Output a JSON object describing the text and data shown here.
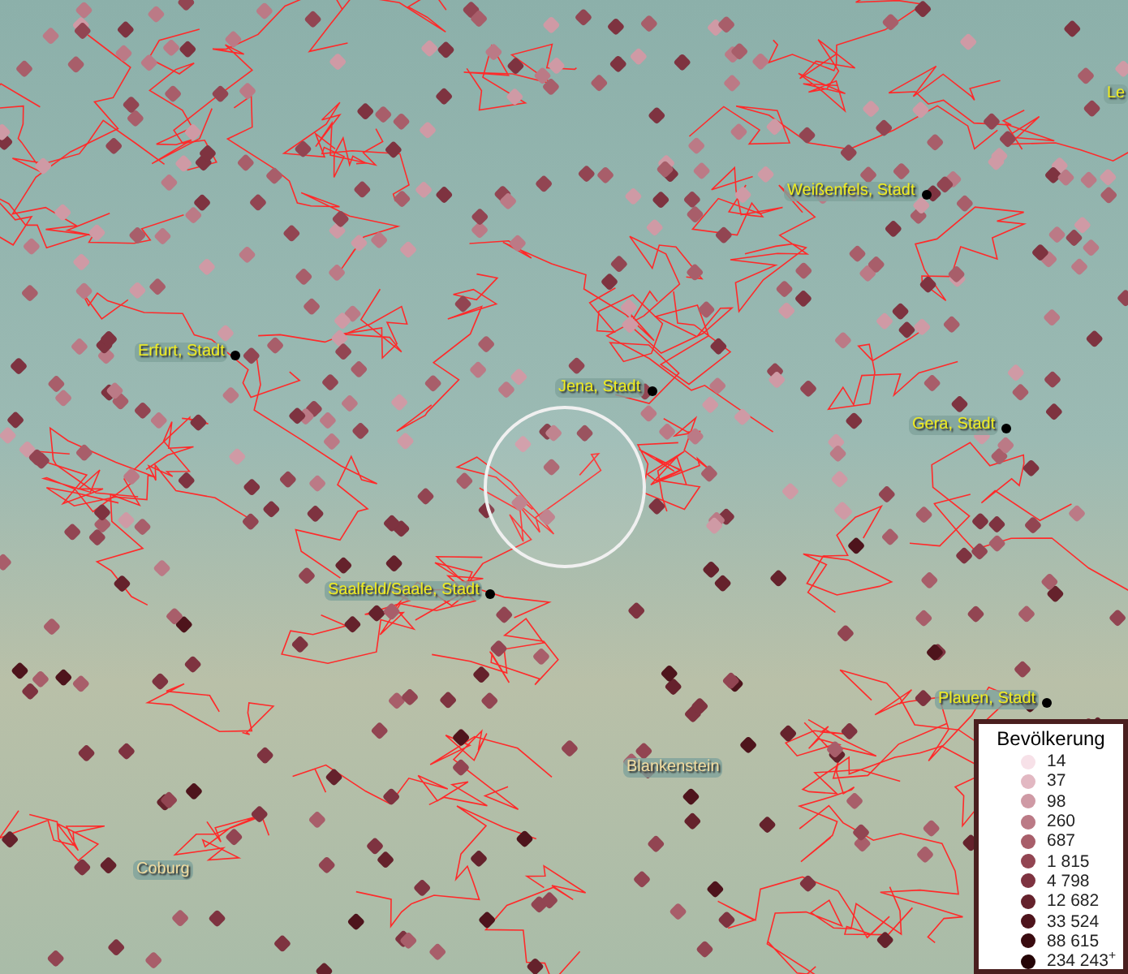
{
  "map": {
    "places": [
      {
        "name": "Le",
        "kind": "city"
      },
      {
        "name": "Weißenfels, Stadt",
        "kind": "city"
      },
      {
        "name": "Erfurt, Stadt",
        "kind": "city"
      },
      {
        "name": "Jena, Stadt",
        "kind": "city"
      },
      {
        "name": "Gera, Stadt",
        "kind": "city"
      },
      {
        "name": "Saalfeld/Saale, Stadt",
        "kind": "city"
      },
      {
        "name": "Plauen, Stadt",
        "kind": "city"
      },
      {
        "name": "Blankenstein",
        "kind": "town"
      },
      {
        "name": "Coburg",
        "kind": "town"
      }
    ]
  },
  "legend": {
    "title": "Bevölkerung",
    "items": [
      {
        "label": "14",
        "color": "#f7e1e8"
      },
      {
        "label": "37",
        "color": "#e2b8c2"
      },
      {
        "label": "98",
        "color": "#cf9aa5"
      },
      {
        "label": "260",
        "color": "#bb7a86"
      },
      {
        "label": "687",
        "color": "#a85e6a"
      },
      {
        "label": "1 815",
        "color": "#924552"
      },
      {
        "label": "4 798",
        "color": "#7e3340"
      },
      {
        "label": "12 682",
        "color": "#65222c"
      },
      {
        "label": "33 524",
        "color": "#4e141c"
      },
      {
        "label": "88 615",
        "color": "#3a0b10"
      },
      {
        "label": "234 243$^{+}$",
        "color": "#250507"
      }
    ]
  }
}
